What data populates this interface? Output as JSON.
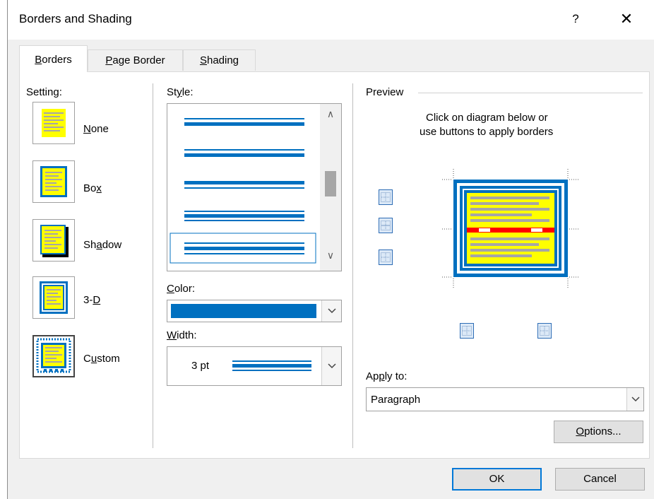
{
  "dialog": {
    "title": "Borders and Shading",
    "help": "?",
    "close": "✕"
  },
  "tabs": [
    {
      "label": "Borders",
      "underline": "B",
      "rest": "orders",
      "active": true
    },
    {
      "label": "Page Border",
      "underline": "P",
      "rest": "age Border",
      "active": false
    },
    {
      "label": "Shading",
      "underline": "S",
      "rest": "hading",
      "active": false
    }
  ],
  "setting": {
    "heading": "Setting:",
    "items": [
      {
        "pre": "",
        "ul": "N",
        "post": "one",
        "label": "None"
      },
      {
        "pre": "Bo",
        "ul": "x",
        "post": "",
        "label": "Box"
      },
      {
        "pre": "Sh",
        "ul": "a",
        "post": "dow",
        "label": "Shadow"
      },
      {
        "pre": "3-",
        "ul": "D",
        "post": "",
        "label": "3-D"
      },
      {
        "pre": "C",
        "ul": "u",
        "post": "stom",
        "label": "Custom"
      }
    ],
    "selected": "Custom"
  },
  "style": {
    "heading_ul": "y",
    "heading_pre": "St",
    "heading_post": "le:",
    "heading": "Style:"
  },
  "color": {
    "heading_ul": "C",
    "heading_post": "olor:",
    "heading": "Color:",
    "value_hex": "#0070c0"
  },
  "width": {
    "heading_ul": "W",
    "heading_post": "idth:",
    "heading": "Width:",
    "value": "3 pt"
  },
  "preview": {
    "heading": "Preview",
    "instruction_line1": "Click on diagram below or",
    "instruction_line2": "use buttons to apply borders"
  },
  "apply_to": {
    "heading_pre": "Ap",
    "heading_ul": "p",
    "heading_post": "ly to:",
    "heading": "Apply to:",
    "value": "Paragraph"
  },
  "buttons": {
    "options_ul": "O",
    "options_post": "ptions...",
    "options": "Options...",
    "ok": "OK",
    "cancel": "Cancel"
  },
  "colors": {
    "accent": "#0070c0",
    "highlight": "#ffff00",
    "red": "#ff0000",
    "text_lines": "#a6a6a6"
  }
}
